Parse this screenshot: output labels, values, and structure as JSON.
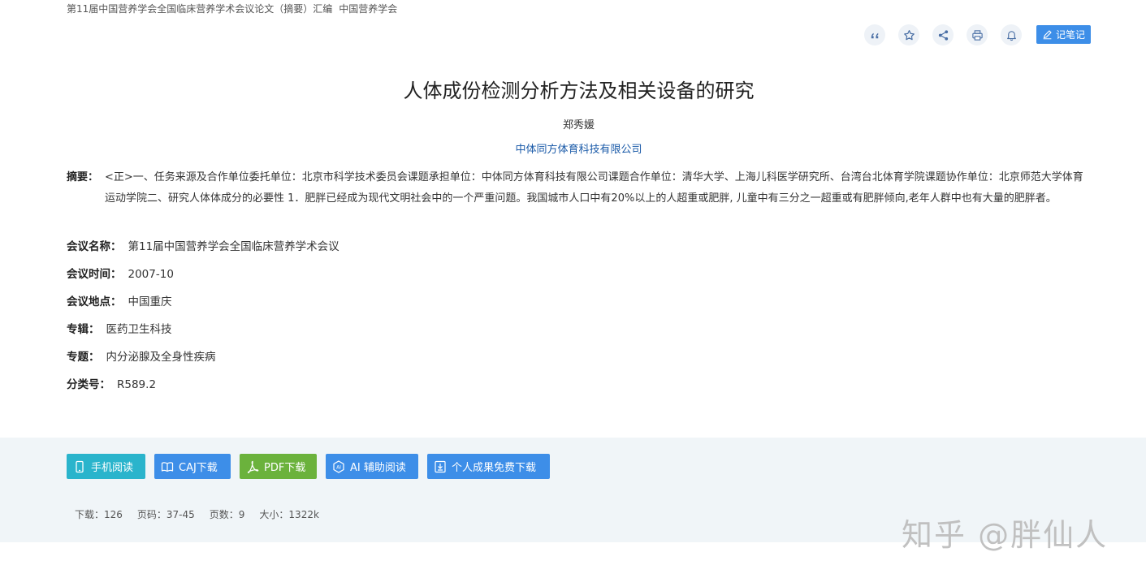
{
  "source": {
    "collection": "第11届中国营养学会全国临床营养学术会议论文（摘要）汇编",
    "organizer": "中国营养学会"
  },
  "toolbar": {
    "note_label": "记笔记"
  },
  "article": {
    "title": "人体成份检测分析方法及相关设备的研究",
    "author": "郑秀媛",
    "affiliation": "中体同方体育科技有限公司"
  },
  "abstract": {
    "label": "摘要：",
    "text": "<正>一、任务来源及合作单位委托单位：北京市科学技术委员会课题承担单位：中体同方体育科技有限公司课题合作单位：清华大学、上海儿科医学研究所、台湾台北体育学院课题协作单位：北京师范大学体育运动学院二、研究人体体成分的必要性 1．肥胖已经成为现代文明社会中的一个严重问题。我国城市人口中有20%以上的人超重或肥胖, 儿童中有三分之一超重或有肥胖倾向,老年人群中也有大量的肥胖者。"
  },
  "meta": [
    {
      "label": "会议名称：",
      "value": "第11届中国营养学会全国临床营养学术会议"
    },
    {
      "label": "会议时间：",
      "value": "2007-10"
    },
    {
      "label": "会议地点：",
      "value": "中国重庆"
    },
    {
      "label": "专辑：",
      "value": "医药卫生科技"
    },
    {
      "label": "专题：",
      "value": "内分泌腺及全身性疾病"
    },
    {
      "label": "分类号：",
      "value": "R589.2"
    }
  ],
  "actions": {
    "mobile_read": "手机阅读",
    "caj_download": "CAJ下载",
    "pdf_download": "PDF下载",
    "ai_read": "AI 辅助阅读",
    "personal_download": "个人成果免费下载"
  },
  "stats": {
    "downloads": "下载：126",
    "pages": "页码：37-45",
    "page_count": "页数：9",
    "size": "大小：1322k"
  },
  "watermark": "知乎 @胖仙人",
  "colors": {
    "accent": "#3d8ee8",
    "teal": "#2ab4cc",
    "green": "#6bb23c",
    "link": "#1a5aa8"
  }
}
